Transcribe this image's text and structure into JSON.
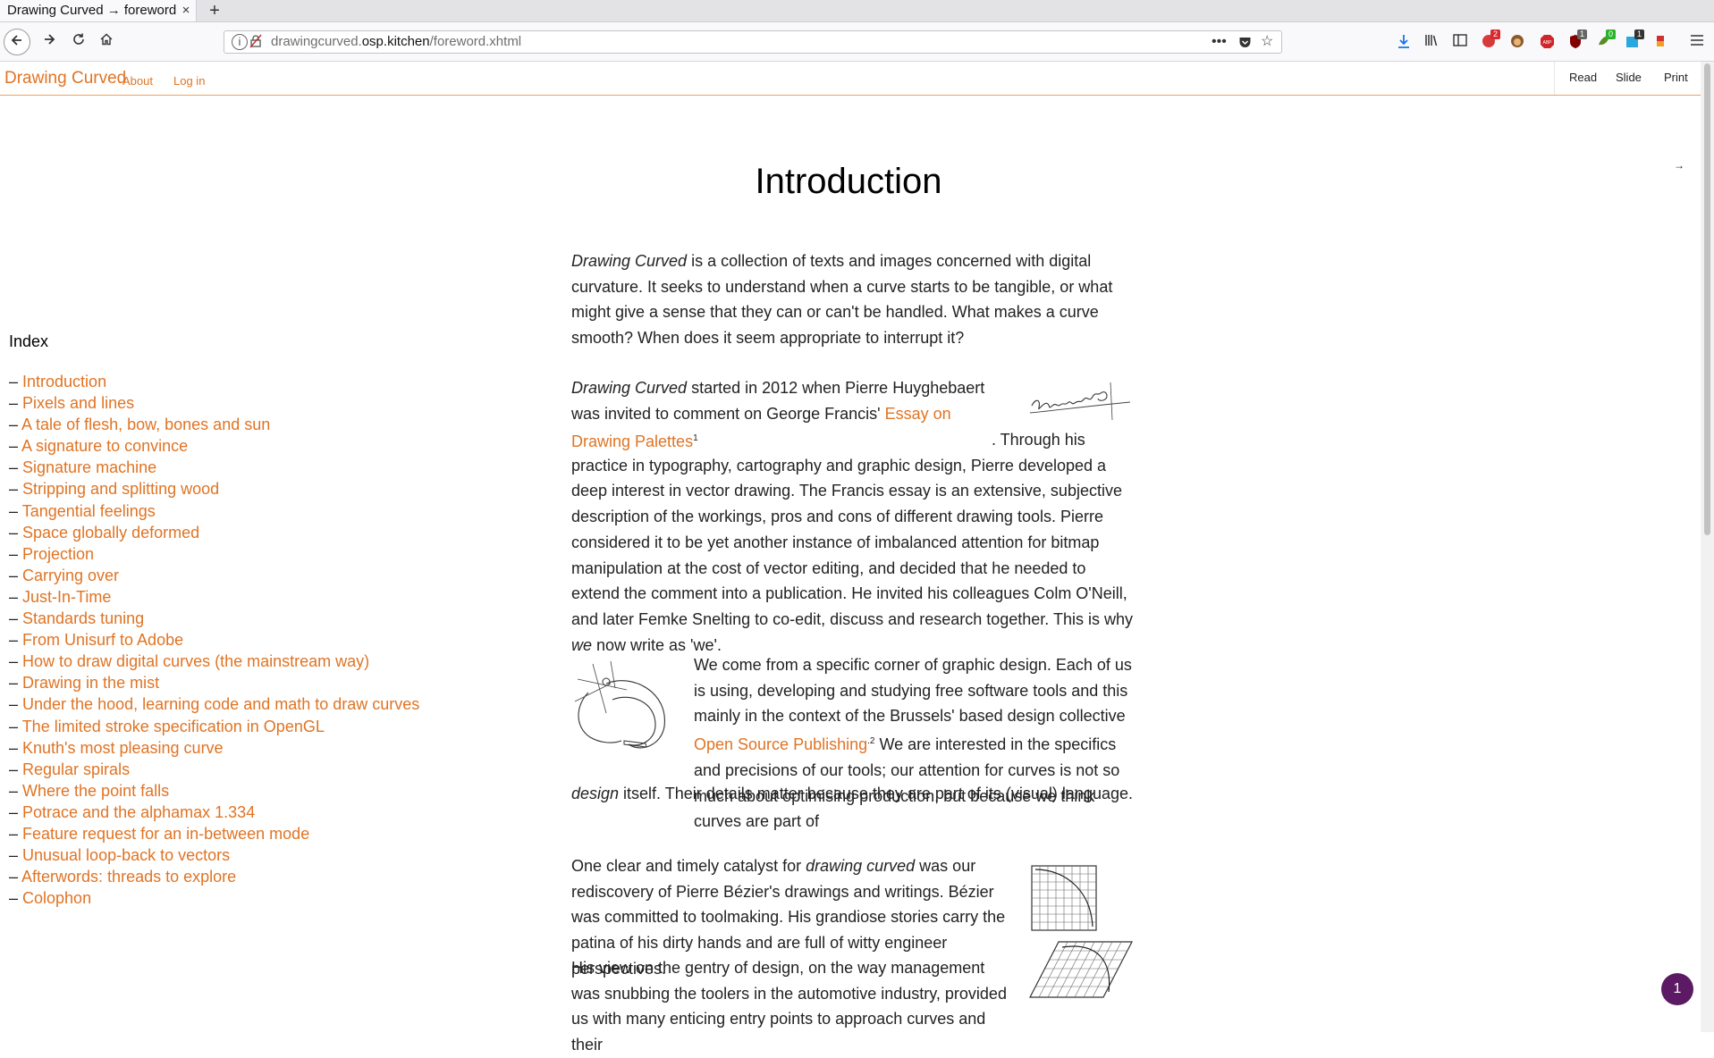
{
  "browser": {
    "tab_title": "Drawing Curved → foreword",
    "tab_close": "×",
    "new_tab": "+",
    "url_prefix": "drawingcurved.",
    "url_domain": "osp.kitchen",
    "url_path": "/foreword.xhtml",
    "badges": [
      "2",
      "1",
      "0",
      "1"
    ]
  },
  "site": {
    "brand": "Drawing Curved",
    "nav": [
      "About",
      "Log in"
    ],
    "modes": [
      "Read",
      "Slide",
      "Print"
    ],
    "arrow": "→"
  },
  "index": {
    "title": "Index",
    "items": [
      "Introduction",
      "Pixels and lines",
      "A tale of flesh, bow, bones and sun",
      "A signature to convince",
      "Signature machine",
      "Stripping and splitting wood",
      "Tangential feelings",
      "Space globally deformed",
      "Projection",
      "Carrying over",
      "Just-In-Time",
      "Standards tuning",
      "From Unisurf to Adobe",
      "How to draw digital curves (the mainstream way)",
      "Drawing in the mist",
      "Under the hood, learning code and math to draw curves",
      "The limited stroke specification in OpenGL",
      "Knuth's most pleasing curve",
      "Regular spirals",
      "Where the point falls",
      "Potrace and the alphamax 1.334",
      "Feature request for an in-between mode",
      "Unusual loop-back to vectors",
      "Afterwords: threads to explore",
      "Colophon"
    ]
  },
  "article": {
    "title": "Introduction",
    "p1": {
      "em": "Drawing Curved",
      "text": " is a collection of texts and images concerned with digital curvature. It seeks to understand when a curve starts to be tangible, or what might give a sense that they can or can't be handled. What makes a curve smooth? When does it seem appropriate to interrupt it?"
    },
    "p2": {
      "em": "Drawing Curved",
      "t1": " started in 2012 when Pierre Huyghebaert was invited to comment on George Francis' ",
      "link": "Essay on Drawing Palettes",
      "sup": "1",
      "t2": ". Through his practice in typography, cartography and graphic design, Pierre developed a deep interest in vector drawing. The Francis essay is an extensive, subjective description of the workings, pros and cons of different drawing tools. Pierre considered it to be yet another instance of imbalanced attention for bitmap manipulation at the cost of vector editing, and decided that he needed to extend the comment into a publication. He invited his colleagues Colm O'Neill, and later Femke Snelting to co-edit, discuss and research together. This is why ",
      "em2": "we",
      "t3": " now write as 'we'."
    },
    "p3": {
      "t1": "We come from a specific corner of graphic design. Each of us is using, developing and studying free software tools and this mainly in the context of the Brussels' based design collective ",
      "link": "Open Source Publishing",
      "sup": ".2",
      "t2": " We are interested in the specifics and precisions of our tools; our attention for curves is not so much about optimising production, but because we think curves are part of ",
      "em": "design",
      "t3": " itself. Their details matter because they are part of its (visual) language."
    },
    "p4": {
      "t1": "One clear and timely catalyst for ",
      "em": "drawing curved",
      "t2": " was our rediscovery of Pierre Bézier's drawings and writings. Bézier was committed to toolmaking. His grandiose stories carry the patina of his dirty hands and are full of witty engineer perspectives.",
      "t3": "His view on the gentry of design, on the way management was snubbing the toolers in the automotive industry, provided us with many enticing entry points to approach curves and their"
    }
  },
  "counter": "1",
  "colors": {
    "accent": "#e07424",
    "counter_bg": "#5c1a64"
  },
  "icons": [
    "back-icon",
    "forward-icon",
    "reload-icon",
    "home-icon",
    "info-icon",
    "lock-icon",
    "more-icon",
    "pocket-icon",
    "star-icon",
    "download-icon",
    "library-icon",
    "sidebar-icon",
    "menu-icon"
  ]
}
